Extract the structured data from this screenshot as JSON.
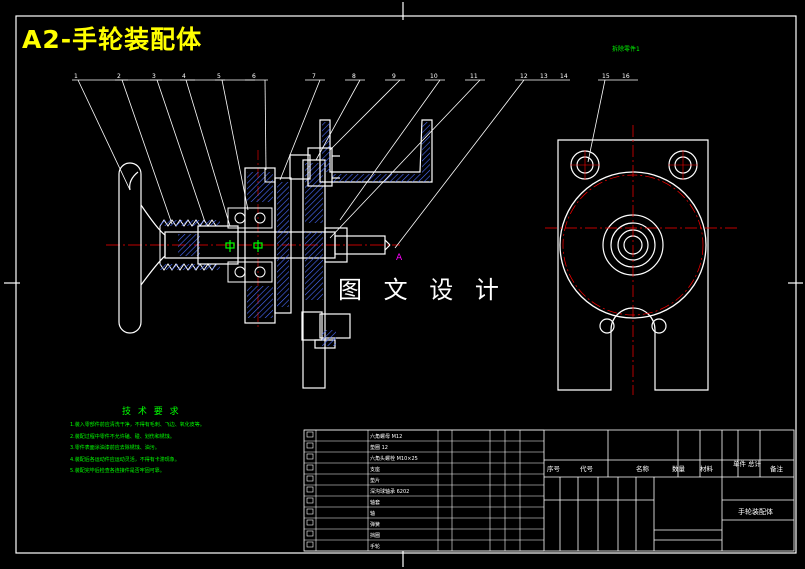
{
  "drawing": {
    "title": "A2-手轮装配体",
    "watermark": "图 文 设 计",
    "part_callouts": [
      "1",
      "2",
      "3",
      "4",
      "5",
      "6",
      "7",
      "8",
      "9",
      "10",
      "11",
      "12",
      "13",
      "14",
      "15",
      "16"
    ],
    "section_mark": "A",
    "view_note": "拆除零件1"
  },
  "technical_requirements": {
    "title": "技 术 要 求",
    "notes": [
      "1.装入零部件前应清洗干净，不得有毛刺、飞边、氧化皮等。",
      "2.装配过程中零件不允许磕、碰、划伤和锈蚀。",
      "3.零件表面涂油漆前应去除锈蚀、油污。",
      "4.装配后各运动件应运动灵活，不得有卡滞现象。",
      "5.装配完毕后检查各连接件是否牢固可靠。"
    ]
  },
  "title_block": {
    "header_labels": [
      "序号",
      "代号",
      "名称",
      "数量",
      "材料",
      "单件",
      "总计",
      "备注"
    ],
    "assembly_name": "手轮装配体",
    "bom_names": [
      "六角螺母 M12",
      "垫圈 12",
      "六角头螺栓 M10×25",
      "支座",
      "垫片",
      "深沟球轴承 6202",
      "轴套",
      "轴",
      "弹簧",
      "挡圈",
      "手轮"
    ]
  },
  "colors": {
    "outline": "#ffffff",
    "centerline": "#ff0000",
    "hatch": "#4a6cff",
    "annotation": "#00ff00",
    "title": "#ffff00",
    "cyan": "#00ffff",
    "section": "#ff00ff"
  }
}
